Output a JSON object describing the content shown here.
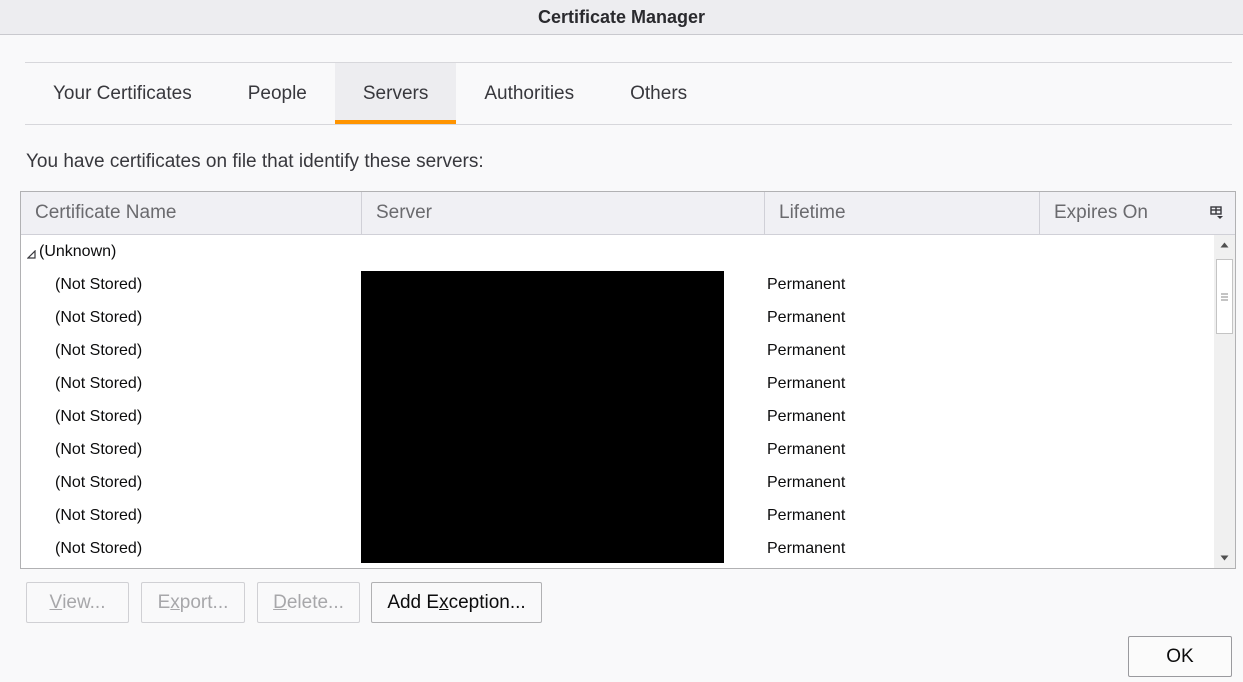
{
  "window": {
    "title": "Certificate Manager"
  },
  "tabs": [
    {
      "label": "Your Certificates",
      "selected": false
    },
    {
      "label": "People",
      "selected": false
    },
    {
      "label": "Servers",
      "selected": true
    },
    {
      "label": "Authorities",
      "selected": false
    },
    {
      "label": "Others",
      "selected": false
    }
  ],
  "description": "You have certificates on file that identify these servers:",
  "table": {
    "columns": [
      "Certificate Name",
      "Server",
      "Lifetime",
      "Expires On"
    ],
    "group": {
      "label": "(Unknown)",
      "twisty": "◢"
    },
    "rows": [
      {
        "name": "(Not Stored)",
        "lifetime": "Permanent"
      },
      {
        "name": "(Not Stored)",
        "lifetime": "Permanent"
      },
      {
        "name": "(Not Stored)",
        "lifetime": "Permanent"
      },
      {
        "name": "(Not Stored)",
        "lifetime": "Permanent"
      },
      {
        "name": "(Not Stored)",
        "lifetime": "Permanent"
      },
      {
        "name": "(Not Stored)",
        "lifetime": "Permanent"
      },
      {
        "name": "(Not Stored)",
        "lifetime": "Permanent"
      },
      {
        "name": "(Not Stored)",
        "lifetime": "Permanent"
      },
      {
        "name": "(Not Stored)",
        "lifetime": "Permanent"
      }
    ],
    "column_picker_icon": "column-picker-icon"
  },
  "buttons": {
    "view": {
      "pre": "",
      "key": "V",
      "post": "iew...",
      "enabled": false
    },
    "export": {
      "pre": "E",
      "key": "x",
      "post": "port...",
      "enabled": false
    },
    "delete": {
      "pre": "",
      "key": "D",
      "post": "elete...",
      "enabled": false
    },
    "add_exception": {
      "pre": "Add E",
      "key": "x",
      "post": "ception...",
      "enabled": true
    },
    "ok": {
      "label": "OK"
    }
  },
  "colors": {
    "tab_accent": "#ff9400",
    "redaction": "#000000"
  }
}
